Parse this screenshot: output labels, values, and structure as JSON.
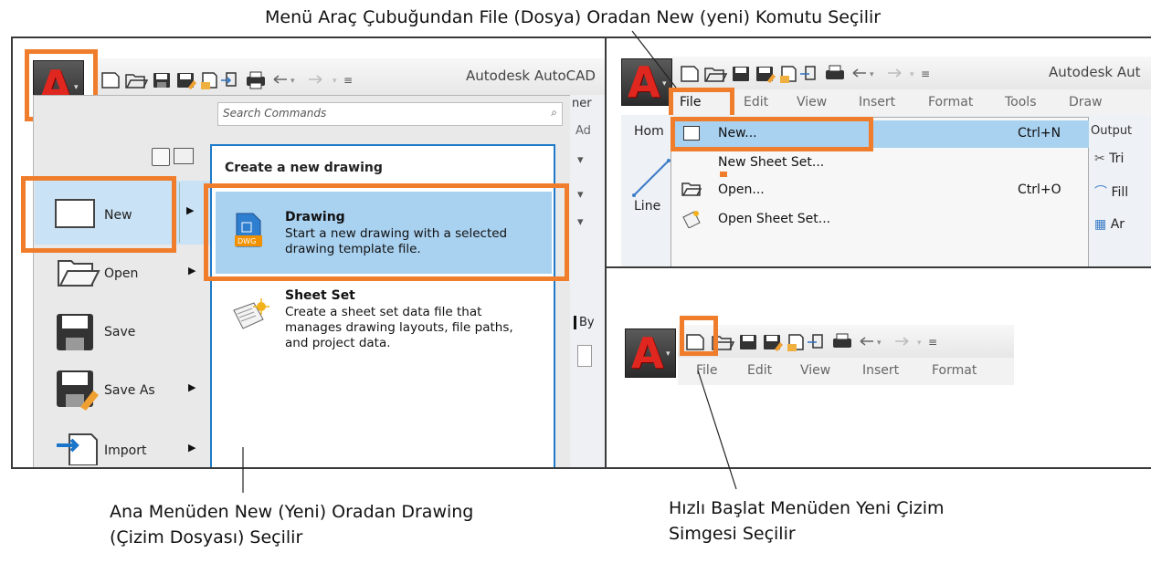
{
  "captions": {
    "top": "Menü Araç Çubuğundan File (Dosya) Oradan New (yeni) Komutu Seçilir",
    "bottom_left_line1": "Ana Menüden New (Yeni) Oradan Drawing",
    "bottom_left_line2": "(Çizim Dosyası) Seçilir",
    "bottom_right_line1": "Hızlı Başlat Menüden Yeni Çizim",
    "bottom_right_line2": "Simgesi Seçilir"
  },
  "left_panel": {
    "app_title": "Autodesk AutoCAD",
    "app_button_letter": "A",
    "search_placeholder": "Search Commands",
    "partial_right": [
      "ner",
      "Ad",
      "By"
    ],
    "menu_items": [
      "New",
      "Open",
      "Save",
      "Save As",
      "Import"
    ],
    "submenu_title": "Create a new drawing",
    "drawing": {
      "title": "Drawing",
      "desc_line1": "Start a new drawing with a selected",
      "desc_line2": "drawing template file.",
      "icon_label": "DWG"
    },
    "sheet_set": {
      "title": "Sheet Set",
      "desc_line1": "Create a sheet set data file that",
      "desc_line2": "manages drawing layouts, file paths,",
      "desc_line3": "and project data."
    }
  },
  "top_right_panel": {
    "app_title": "Autodesk Aut",
    "menubar": [
      "File",
      "Edit",
      "View",
      "Insert",
      "Format",
      "Tools",
      "Draw"
    ],
    "ribbon_partial": [
      "Hom",
      "Output"
    ],
    "line_label": "Line",
    "right_tools": [
      "Tri",
      "Fill",
      "Ar"
    ],
    "file_menu": [
      {
        "label": "New...",
        "shortcut": "Ctrl+N"
      },
      {
        "label": "New Sheet Set...",
        "shortcut": ""
      },
      {
        "label": "Open...",
        "shortcut": "Ctrl+O"
      },
      {
        "label": "Open Sheet Set...",
        "shortcut": ""
      }
    ]
  },
  "bottom_right_panel": {
    "menubar": [
      "File",
      "Edit",
      "View",
      "Insert",
      "Format"
    ]
  },
  "colors": {
    "highlight": "#ef7d2c",
    "selection": "#a9d1f0",
    "autocad_red": "#e0271f"
  }
}
